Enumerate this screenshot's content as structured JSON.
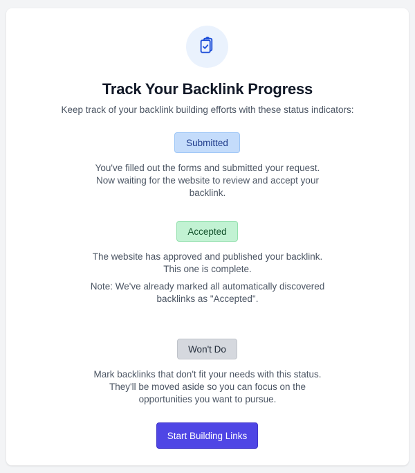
{
  "header": {
    "icon": "clipboard-check-icon",
    "title": "Track Your Backlink Progress",
    "subtitle": "Keep track of your backlink building efforts with these status indicators:"
  },
  "statuses": [
    {
      "label": "Submitted",
      "color": "#c4dcfb",
      "description": "You've filled out the forms and submitted your request. Now waiting for the website to review and accept your backlink."
    },
    {
      "label": "Accepted",
      "color": "#c2f2d3",
      "description": "The website has approved and published your backlink. This one is complete.",
      "note": "Note: We've already marked all automatically discovered backlinks as \"Accepted\"."
    },
    {
      "label": "Won't Do",
      "color": "#d5d8de",
      "description": "Mark backlinks that don't fit your needs with this status. They'll be moved aside so you can focus on the opportunities you want to pursue."
    }
  ],
  "cta": {
    "label": "Start Building Links",
    "color": "#4f46e5"
  }
}
